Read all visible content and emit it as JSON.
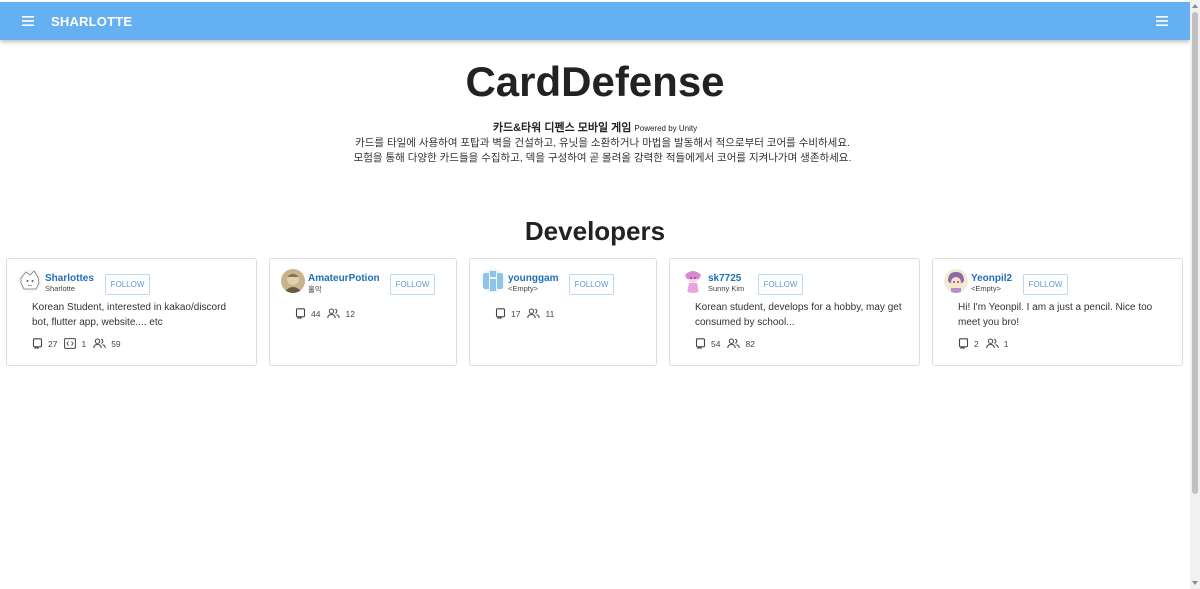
{
  "appbar": {
    "title": "SHARLOTTE",
    "left_icon": "menu-icon",
    "right_icon": "menu-icon"
  },
  "hero": {
    "title": "CardDefense",
    "subtitle": "카드&타워 디펜스 모바일 게임",
    "powered": "Powered by Unity",
    "desc_line1": "카드를 타일에 사용하여 포탑과 벽을 건설하고, 유닛을 소환하거나 마법을 발동해서 적으로부터 코어를 수비하세요.",
    "desc_line2": "모험을 통해 다양한 카드들을 수집하고, 덱을 구성하여 곧 몰려올 강력한 적들에게서 코어를 지켜나가며 생존하세요."
  },
  "developers": {
    "heading": "Developers",
    "follow_label": "FOLLOW",
    "cards": [
      {
        "name": "Sharlottes",
        "sub": "Sharlotte",
        "bio": "Korean Student, interested in kakao/discord bot, flutter app, website.... etc",
        "repos": "27",
        "gists": "1",
        "followers": "59"
      },
      {
        "name": "AmateurPotion",
        "sub": "홀악",
        "bio": "",
        "repos": "44",
        "followers": "12"
      },
      {
        "name": "younggam",
        "sub": "<Empty>",
        "bio": "",
        "repos": "17",
        "followers": "11"
      },
      {
        "name": "sk7725",
        "sub": "Sunny Kim",
        "bio": "Korean student, develops for a hobby, may get consumed by school...",
        "repos": "54",
        "followers": "82"
      },
      {
        "name": "Yeonpil2",
        "sub": "<Empty>",
        "bio": "Hi! I'm Yeonpil. I am a just a pencil. Nice too meet you bro!",
        "repos": "2",
        "followers": "1"
      }
    ]
  },
  "colors": {
    "appbar": "#64b0f2",
    "link": "#1f6fb8",
    "follow": "#5a9ad2"
  }
}
